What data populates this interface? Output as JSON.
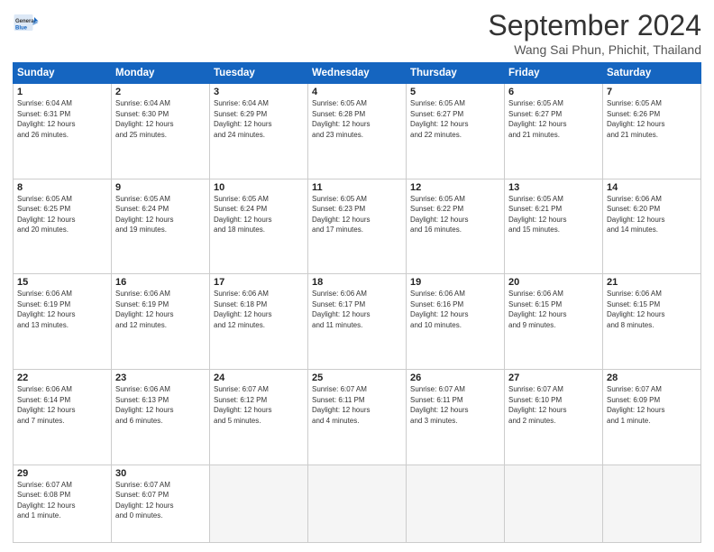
{
  "header": {
    "logo_general": "General",
    "logo_blue": "Blue",
    "month": "September 2024",
    "location": "Wang Sai Phun, Phichit, Thailand"
  },
  "weekdays": [
    "Sunday",
    "Monday",
    "Tuesday",
    "Wednesday",
    "Thursday",
    "Friday",
    "Saturday"
  ],
  "weeks": [
    [
      {
        "day": "1",
        "info": "Sunrise: 6:04 AM\nSunset: 6:31 PM\nDaylight: 12 hours\nand 26 minutes."
      },
      {
        "day": "2",
        "info": "Sunrise: 6:04 AM\nSunset: 6:30 PM\nDaylight: 12 hours\nand 25 minutes."
      },
      {
        "day": "3",
        "info": "Sunrise: 6:04 AM\nSunset: 6:29 PM\nDaylight: 12 hours\nand 24 minutes."
      },
      {
        "day": "4",
        "info": "Sunrise: 6:05 AM\nSunset: 6:28 PM\nDaylight: 12 hours\nand 23 minutes."
      },
      {
        "day": "5",
        "info": "Sunrise: 6:05 AM\nSunset: 6:27 PM\nDaylight: 12 hours\nand 22 minutes."
      },
      {
        "day": "6",
        "info": "Sunrise: 6:05 AM\nSunset: 6:27 PM\nDaylight: 12 hours\nand 21 minutes."
      },
      {
        "day": "7",
        "info": "Sunrise: 6:05 AM\nSunset: 6:26 PM\nDaylight: 12 hours\nand 21 minutes."
      }
    ],
    [
      {
        "day": "8",
        "info": "Sunrise: 6:05 AM\nSunset: 6:25 PM\nDaylight: 12 hours\nand 20 minutes."
      },
      {
        "day": "9",
        "info": "Sunrise: 6:05 AM\nSunset: 6:24 PM\nDaylight: 12 hours\nand 19 minutes."
      },
      {
        "day": "10",
        "info": "Sunrise: 6:05 AM\nSunset: 6:24 PM\nDaylight: 12 hours\nand 18 minutes."
      },
      {
        "day": "11",
        "info": "Sunrise: 6:05 AM\nSunset: 6:23 PM\nDaylight: 12 hours\nand 17 minutes."
      },
      {
        "day": "12",
        "info": "Sunrise: 6:05 AM\nSunset: 6:22 PM\nDaylight: 12 hours\nand 16 minutes."
      },
      {
        "day": "13",
        "info": "Sunrise: 6:05 AM\nSunset: 6:21 PM\nDaylight: 12 hours\nand 15 minutes."
      },
      {
        "day": "14",
        "info": "Sunrise: 6:06 AM\nSunset: 6:20 PM\nDaylight: 12 hours\nand 14 minutes."
      }
    ],
    [
      {
        "day": "15",
        "info": "Sunrise: 6:06 AM\nSunset: 6:19 PM\nDaylight: 12 hours\nand 13 minutes."
      },
      {
        "day": "16",
        "info": "Sunrise: 6:06 AM\nSunset: 6:19 PM\nDaylight: 12 hours\nand 12 minutes."
      },
      {
        "day": "17",
        "info": "Sunrise: 6:06 AM\nSunset: 6:18 PM\nDaylight: 12 hours\nand 12 minutes."
      },
      {
        "day": "18",
        "info": "Sunrise: 6:06 AM\nSunset: 6:17 PM\nDaylight: 12 hours\nand 11 minutes."
      },
      {
        "day": "19",
        "info": "Sunrise: 6:06 AM\nSunset: 6:16 PM\nDaylight: 12 hours\nand 10 minutes."
      },
      {
        "day": "20",
        "info": "Sunrise: 6:06 AM\nSunset: 6:15 PM\nDaylight: 12 hours\nand 9 minutes."
      },
      {
        "day": "21",
        "info": "Sunrise: 6:06 AM\nSunset: 6:15 PM\nDaylight: 12 hours\nand 8 minutes."
      }
    ],
    [
      {
        "day": "22",
        "info": "Sunrise: 6:06 AM\nSunset: 6:14 PM\nDaylight: 12 hours\nand 7 minutes."
      },
      {
        "day": "23",
        "info": "Sunrise: 6:06 AM\nSunset: 6:13 PM\nDaylight: 12 hours\nand 6 minutes."
      },
      {
        "day": "24",
        "info": "Sunrise: 6:07 AM\nSunset: 6:12 PM\nDaylight: 12 hours\nand 5 minutes."
      },
      {
        "day": "25",
        "info": "Sunrise: 6:07 AM\nSunset: 6:11 PM\nDaylight: 12 hours\nand 4 minutes."
      },
      {
        "day": "26",
        "info": "Sunrise: 6:07 AM\nSunset: 6:11 PM\nDaylight: 12 hours\nand 3 minutes."
      },
      {
        "day": "27",
        "info": "Sunrise: 6:07 AM\nSunset: 6:10 PM\nDaylight: 12 hours\nand 2 minutes."
      },
      {
        "day": "28",
        "info": "Sunrise: 6:07 AM\nSunset: 6:09 PM\nDaylight: 12 hours\nand 1 minute."
      }
    ],
    [
      {
        "day": "29",
        "info": "Sunrise: 6:07 AM\nSunset: 6:08 PM\nDaylight: 12 hours\nand 1 minute."
      },
      {
        "day": "30",
        "info": "Sunrise: 6:07 AM\nSunset: 6:07 PM\nDaylight: 12 hours\nand 0 minutes."
      },
      {
        "day": "",
        "info": ""
      },
      {
        "day": "",
        "info": ""
      },
      {
        "day": "",
        "info": ""
      },
      {
        "day": "",
        "info": ""
      },
      {
        "day": "",
        "info": ""
      }
    ]
  ]
}
